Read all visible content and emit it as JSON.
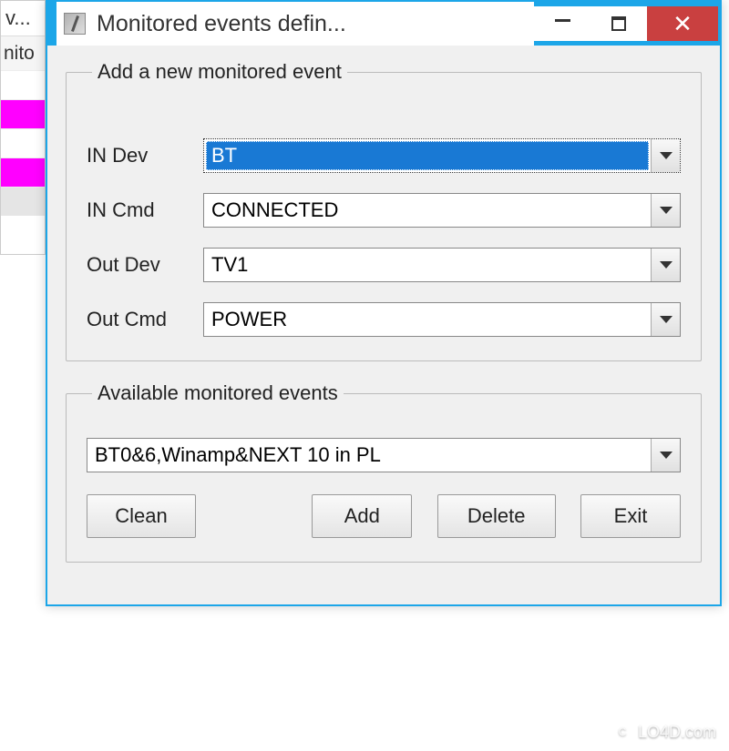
{
  "background": {
    "title_fragment": "v...",
    "tab_fragment": "nito"
  },
  "dialog": {
    "title": "Monitored events defin...",
    "groups": {
      "add_event": {
        "legend": "Add a new monitored event",
        "fields": {
          "in_dev": {
            "label": "IN Dev",
            "value": "BT"
          },
          "in_cmd": {
            "label": "IN Cmd",
            "value": "CONNECTED"
          },
          "out_dev": {
            "label": "Out Dev",
            "value": "TV1"
          },
          "out_cmd": {
            "label": "Out Cmd",
            "value": "POWER"
          }
        }
      },
      "available": {
        "legend": "Available monitored events",
        "selected": "BT0&6,Winamp&NEXT 10 in PL"
      }
    },
    "buttons": {
      "clean": "Clean",
      "add": "Add",
      "delete": "Delete",
      "exit": "Exit"
    }
  },
  "watermark": "LO4D.com"
}
